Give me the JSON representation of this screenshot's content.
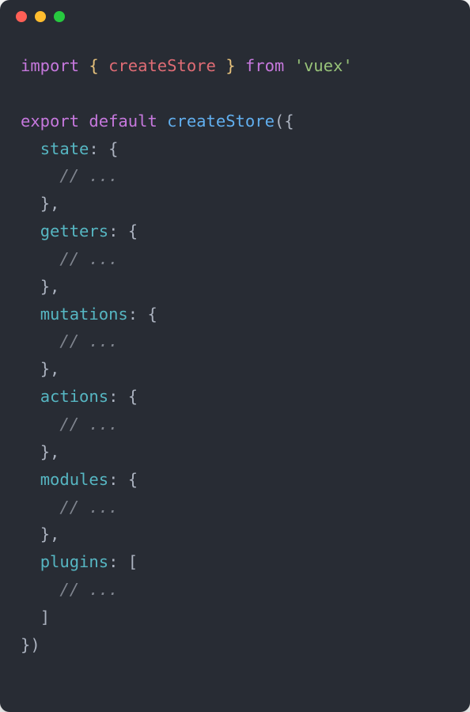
{
  "code": {
    "kw_import": "import",
    "brace_open_y": "{",
    "ident_createStore": "createStore",
    "brace_close_y": "}",
    "kw_from": "from",
    "str_vuex": "'vuex'",
    "kw_export": "export",
    "kw_default": "default",
    "fn_createStore": "createStore",
    "paren_open": "(",
    "obj_open": "{",
    "prop_state": "state",
    "colon": ":",
    "block_open": "{",
    "comment": "// ...",
    "block_close": "}",
    "comma": ",",
    "prop_getters": "getters",
    "prop_mutations": "mutations",
    "prop_actions": "actions",
    "prop_modules": "modules",
    "prop_plugins": "plugins",
    "array_open": "[",
    "array_close": "]",
    "obj_close": "}",
    "paren_close": ")"
  },
  "indent": {
    "i1": "  ",
    "i2": "    "
  }
}
